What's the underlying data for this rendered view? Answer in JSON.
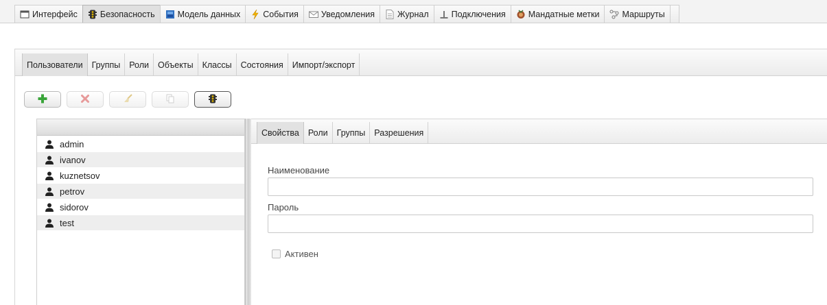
{
  "top_tabs": [
    {
      "label": "Интерфейс",
      "icon": "window-icon"
    },
    {
      "label": "Безопасность",
      "icon": "traffic-light-icon"
    },
    {
      "label": "Модель данных",
      "icon": "data-model-icon"
    },
    {
      "label": "События",
      "icon": "lightning-icon"
    },
    {
      "label": "Уведомления",
      "icon": "envelope-icon"
    },
    {
      "label": "Журнал",
      "icon": "journal-icon"
    },
    {
      "label": "Подключения",
      "icon": "connection-icon"
    },
    {
      "label": "Мандатные метки",
      "icon": "mandatory-label-icon"
    },
    {
      "label": "Маршруты",
      "icon": "routes-icon"
    }
  ],
  "sub_tabs": [
    "Пользователи",
    "Группы",
    "Роли",
    "Объекты",
    "Классы",
    "Состояния",
    "Импорт/экспорт"
  ],
  "toolbar": {
    "buttons": [
      {
        "name": "add-button",
        "icon": "plus-icon"
      },
      {
        "name": "delete-button",
        "icon": "cross-icon"
      },
      {
        "name": "clear-button",
        "icon": "broom-icon"
      },
      {
        "name": "copy-button",
        "icon": "copy-icon"
      },
      {
        "name": "security-button",
        "icon": "traffic-light-icon"
      }
    ]
  },
  "users": [
    "admin",
    "ivanov",
    "kuznetsov",
    "petrov",
    "sidorov",
    "test"
  ],
  "detail_tabs": [
    "Свойства",
    "Роли",
    "Группы",
    "Разрешения"
  ],
  "form": {
    "name_label": "Наименование",
    "name_value": "",
    "password_label": "Пароль",
    "password_value": "",
    "active_label": "Активен",
    "active_checked": false
  },
  "colors": {
    "add_green": "#3aa53a",
    "delete_red": "#e07a7a",
    "accent_blue": "#3a7fd0",
    "lightning_yellow": "#f2b400"
  }
}
